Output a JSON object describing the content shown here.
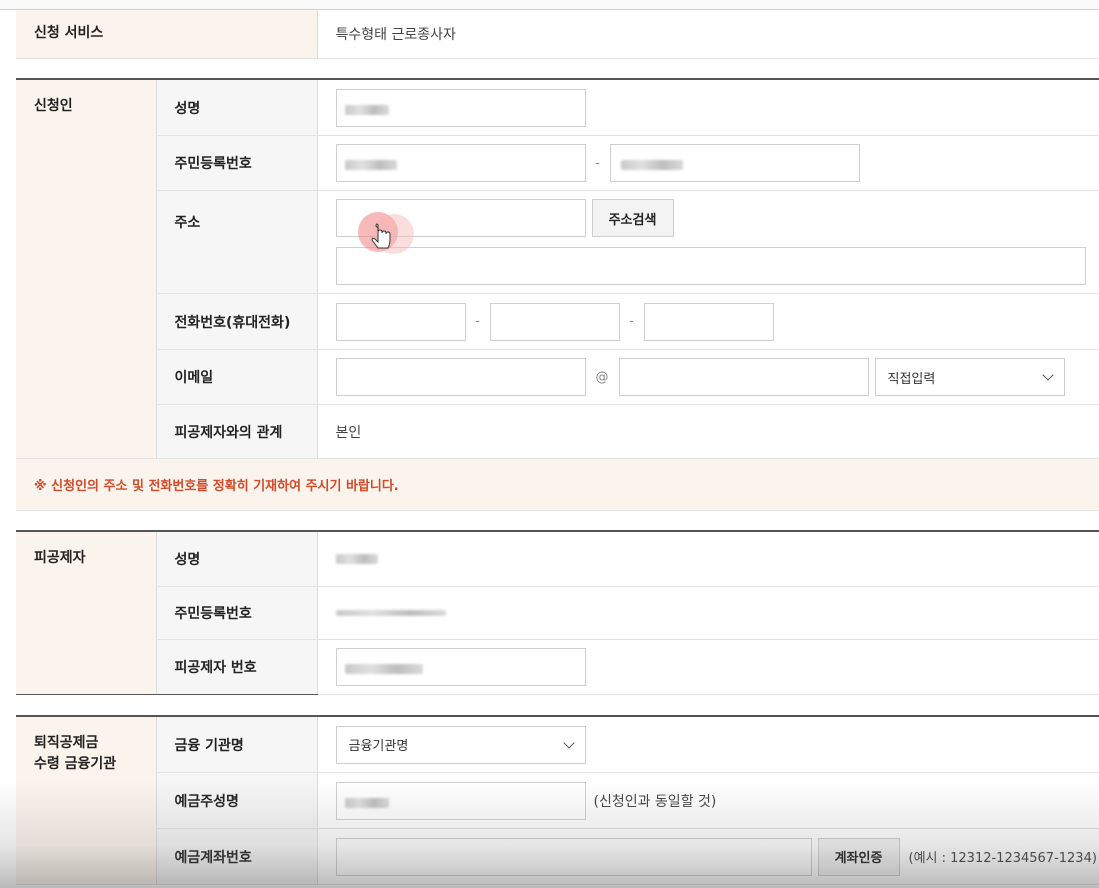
{
  "service": {
    "label": "신청 서비스",
    "value": "특수형태 근로종사자"
  },
  "applicant": {
    "section": "신청인",
    "name_label": "성명",
    "rrn_label": "주민등록번호",
    "address_label": "주소",
    "address_search": "주소검색",
    "phone_label": "전화번호(휴대전화)",
    "email_label": "이메일",
    "email_at": "@",
    "email_domain_select": "직접입력",
    "relation_label": "피공제자와의 관계",
    "relation_value": "본인",
    "notice": "※ 신청인의 주소 및 전화번호를 정확히 기재하여 주시기 바랍니다."
  },
  "insured": {
    "section": "피공제자",
    "name_label": "성명",
    "rrn_label": "주민등록번호",
    "number_label": "피공제자 번호"
  },
  "bank": {
    "section_line1": "퇴직공제금",
    "section_line2": "수령 금융기관",
    "bank_label": "금융 기관명",
    "bank_select": "금융기관명",
    "holder_label": "예금주성명",
    "holder_note": "(신청인과 동일할 것)",
    "account_label": "예금계좌번호",
    "account_verify": "계좌인증",
    "account_example": "(예시 : 12312-1234567-1234)"
  },
  "dash": "-"
}
